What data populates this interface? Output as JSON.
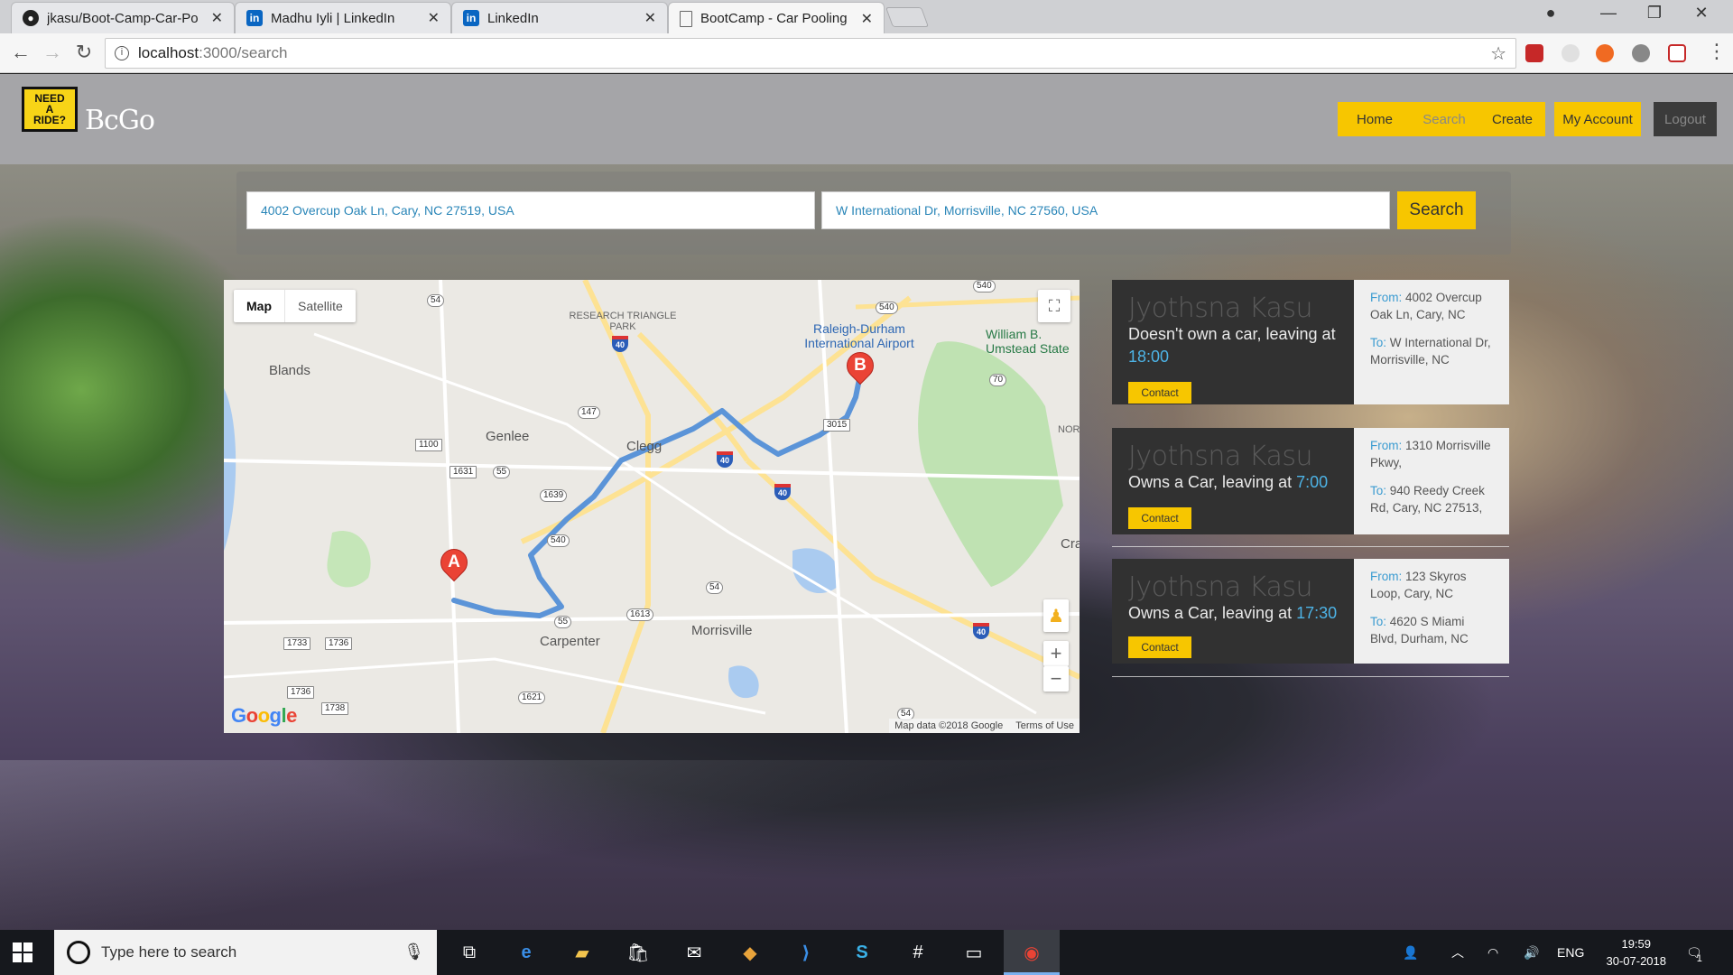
{
  "browser": {
    "tabs": [
      {
        "label": "jkasu/Boot-Camp-Car-Po",
        "icon": "github-icon"
      },
      {
        "label": "Madhu Iyli | LinkedIn",
        "icon": "linkedin-icon"
      },
      {
        "label": "LinkedIn",
        "icon": "linkedin-icon"
      },
      {
        "label": "BootCamp - Car Pooling",
        "icon": "page-icon",
        "active": true
      }
    ],
    "url_host": "localhost",
    "url_path": ":3000/search"
  },
  "site": {
    "logo_lines": [
      "NEED",
      "A",
      "RIDE?"
    ],
    "brand": "BcGo",
    "nav": [
      "Home",
      "Search",
      "Create",
      "My Account",
      "Logout"
    ]
  },
  "search": {
    "from": "4002 Overcup Oak Ln, Cary, NC 27519, USA",
    "to": "W International Dr, Morrisville, NC 27560, USA",
    "button": "Search"
  },
  "map": {
    "types": [
      "Map",
      "Satellite"
    ],
    "footer_data": "Map data ©2018 Google",
    "footer_terms": "Terms of Use",
    "google_logo": "Google",
    "labels": {
      "blands": "Blands",
      "genlee": "Genlee",
      "clegg": "Clegg",
      "carpenter": "Carpenter",
      "morrisville": "Morrisville",
      "rtp": "RESEARCH TRIANGLE PARK",
      "airport": "Raleigh-Durham International Airport",
      "umstead": "William B. Umstead State",
      "cra": "Cra",
      "nor": "NOR"
    },
    "marker_a": "A",
    "marker_b": "B",
    "shields": [
      "54",
      "147",
      "1100",
      "1631",
      "55",
      "1639",
      "540",
      "1613",
      "54",
      "55",
      "1733",
      "1736",
      "1736",
      "1738",
      "1621",
      "54",
      "70",
      "3015",
      "540",
      "540",
      "40",
      "40",
      "40",
      "40"
    ]
  },
  "rides": [
    {
      "name": "Jyothsna Kasu",
      "desc_prefix": "Doesn't own a car, leaving at ",
      "time": "18:00",
      "contact": "Contact",
      "from_label": "From:",
      "from": "4002 Overcup Oak Ln, Cary, NC",
      "to_label": "To:",
      "to": "W International Dr, Morrisville, NC"
    },
    {
      "name": "Jyothsna Kasu",
      "desc_prefix": "Owns a Car, leaving at ",
      "time": "7:00",
      "contact": "Contact",
      "from_label": "From:",
      "from": "1310 Morrisville Pkwy,",
      "to_label": "To:",
      "to": "940 Reedy Creek Rd, Cary, NC 27513,"
    },
    {
      "name": "Jyothsna Kasu",
      "desc_prefix": "Owns a Car, leaving at ",
      "time": "17:30",
      "contact": "Contact",
      "from_label": "From:",
      "from": "123 Skyros Loop, Cary, NC",
      "to_label": "To:",
      "to": "4620 S Miami Blvd, Durham, NC"
    }
  ],
  "taskbar": {
    "search_placeholder": "Type here to search",
    "lang": "ENG",
    "time": "19:59",
    "date": "30-07-2018",
    "notifications": "1"
  }
}
